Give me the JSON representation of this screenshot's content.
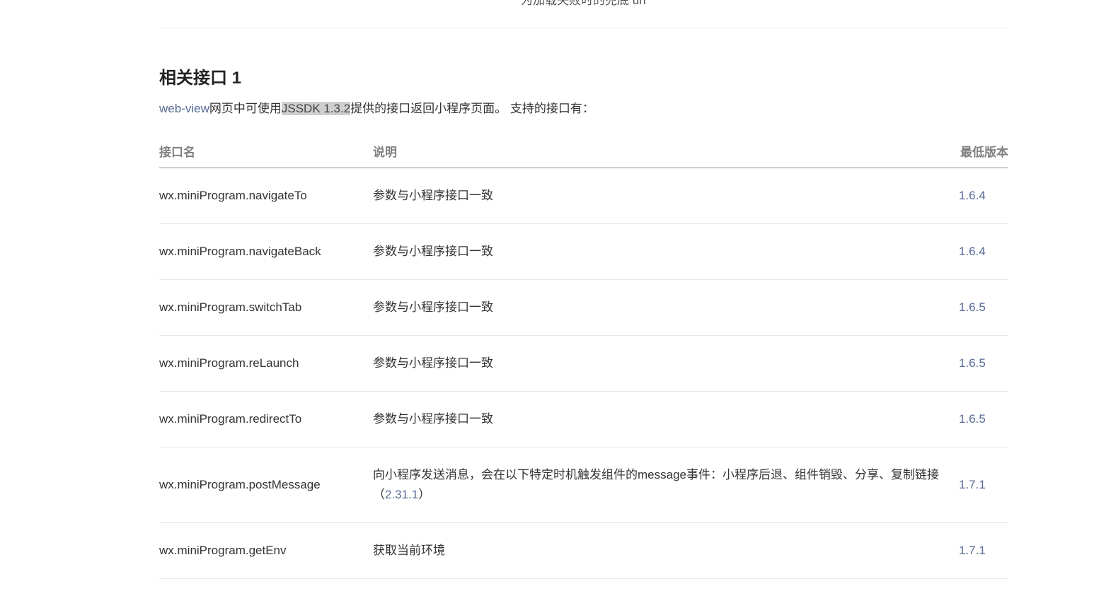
{
  "top_text": "为加载失败时的兜底 url",
  "section": {
    "title": "相关接口 1",
    "intro_link": "web-view",
    "intro_text_1": "网页中可使用",
    "intro_highlight": "JSSDK 1.3.2",
    "intro_text_2": "提供的接口返回小程序页面。 支持的接口有："
  },
  "table": {
    "headers": [
      "接口名",
      "说明",
      "最低版本"
    ],
    "rows": [
      {
        "name": "wx.miniProgram.navigateTo",
        "desc": "参数与小程序接口一致",
        "desc_version": "",
        "version": "1.6.4"
      },
      {
        "name": "wx.miniProgram.navigateBack",
        "desc": "参数与小程序接口一致",
        "desc_version": "",
        "version": "1.6.4"
      },
      {
        "name": "wx.miniProgram.switchTab",
        "desc": "参数与小程序接口一致",
        "desc_version": "",
        "version": "1.6.5"
      },
      {
        "name": "wx.miniProgram.reLaunch",
        "desc": "参数与小程序接口一致",
        "desc_version": "",
        "version": "1.6.5"
      },
      {
        "name": "wx.miniProgram.redirectTo",
        "desc": "参数与小程序接口一致",
        "desc_version": "",
        "version": "1.6.5"
      },
      {
        "name": "wx.miniProgram.postMessage",
        "desc": "向小程序发送消息，会在以下特定时机触发组件的message事件：小程序后退、组件销毁、分享、复制链接（",
        "desc_version": "2.31.1",
        "desc_suffix": "）",
        "version": "1.7.1"
      },
      {
        "name": "wx.miniProgram.getEnv",
        "desc": "获取当前环境",
        "desc_version": "",
        "version": "1.7.1"
      }
    ]
  },
  "colors": {
    "link": "#576b95",
    "header_text": "#808080",
    "body_text": "#333333",
    "divider": "#e7e7e7"
  }
}
